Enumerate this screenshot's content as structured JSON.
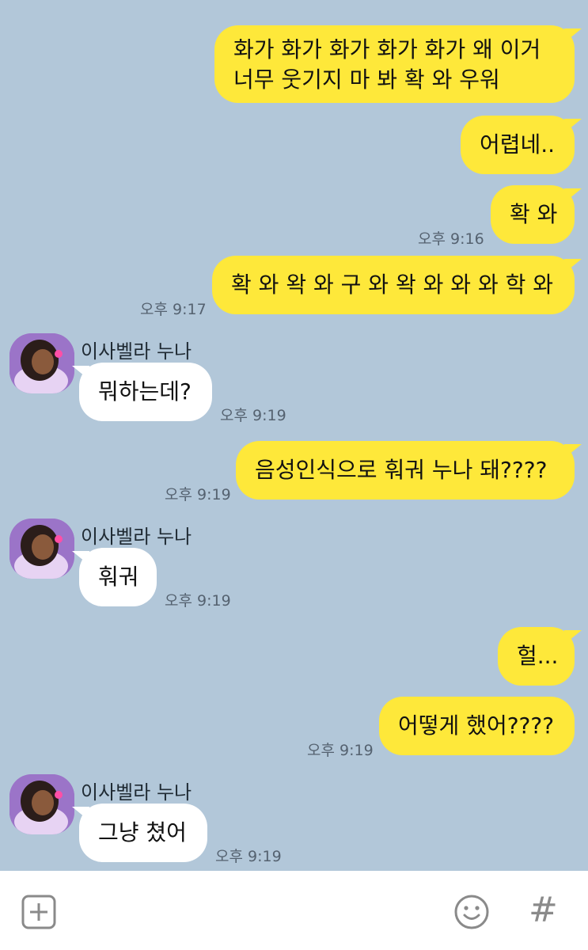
{
  "colors": {
    "background": "#b2c7d9",
    "my_bubble": "#fee83a",
    "their_bubble": "#ffffff"
  },
  "contact_name": "이사벨라 누나",
  "messages": [
    {
      "from": "me",
      "lines": [
        "화가 화가 화가 화가 화가 왜 이거",
        "너무 웃기지 마 봐 확 와 우워"
      ]
    },
    {
      "from": "me",
      "text": "어렵네.."
    },
    {
      "from": "me",
      "text": "확 와",
      "time": "오후 9:16"
    },
    {
      "from": "me",
      "text": "확 와 왁 와 구 와 왁 와 와 와 학 와",
      "time": "오후 9:17"
    },
    {
      "from": "them",
      "text": "뭐하는데?",
      "time": "오후 9:19"
    },
    {
      "from": "me",
      "text": "음성인식으로 훠궈 누나 돼????",
      "time": "오후 9:19"
    },
    {
      "from": "them",
      "text": "훠궈",
      "time": "오후 9:19"
    },
    {
      "from": "me",
      "text": "헐..."
    },
    {
      "from": "me",
      "text": "어떻게 했어????",
      "time": "오후 9:19"
    },
    {
      "from": "them",
      "text": "그냥 쳤어",
      "time": "오후 9:19"
    }
  ],
  "input_bar": {
    "add_icon": "plus-square-icon",
    "emoji_icon": "smiley-icon",
    "hash_icon": "hash-icon",
    "hash_label": "#"
  }
}
